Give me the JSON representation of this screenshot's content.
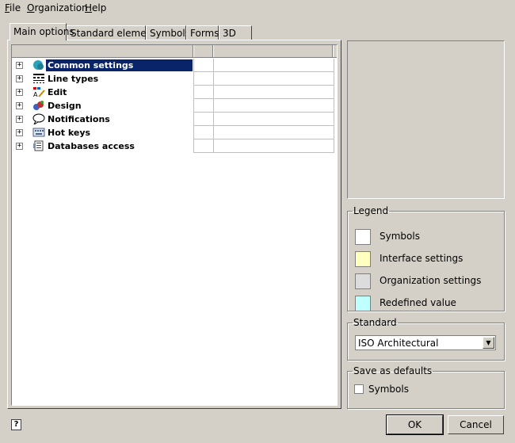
{
  "menu": {
    "file": "File",
    "organization": "Organization",
    "help": "Help"
  },
  "tabs": [
    {
      "label": "Main options",
      "active": true
    },
    {
      "label": "Standard elements",
      "active": false
    },
    {
      "label": "Symbols",
      "active": false
    },
    {
      "label": "Forms",
      "active": false
    },
    {
      "label": "3D",
      "active": false
    }
  ],
  "tree": {
    "items": [
      {
        "label": "Common settings",
        "icon": "common-settings-icon",
        "selected": true
      },
      {
        "label": "Line types",
        "icon": "line-types-icon",
        "selected": false
      },
      {
        "label": "Edit",
        "icon": "edit-icon",
        "selected": false
      },
      {
        "label": "Design",
        "icon": "design-icon",
        "selected": false
      },
      {
        "label": "Notifications",
        "icon": "notifications-icon",
        "selected": false
      },
      {
        "label": "Hot keys",
        "icon": "hot-keys-icon",
        "selected": false
      },
      {
        "label": "Databases access",
        "icon": "databases-access-icon",
        "selected": false
      }
    ]
  },
  "legend": {
    "title": "Legend",
    "items": [
      {
        "label": "Symbols",
        "color": "#ffffff"
      },
      {
        "label": "Interface settings",
        "color": "#ffffc0"
      },
      {
        "label": "Organization settings",
        "color": "#dcdcdc"
      },
      {
        "label": "Redefined value",
        "color": "#c0ffff"
      }
    ]
  },
  "standard": {
    "title": "Standard",
    "selected": "ISO Architectural"
  },
  "save_defaults": {
    "title": "Save as defaults",
    "checkbox_label": "Symbols",
    "checked": false
  },
  "buttons": {
    "ok": "OK",
    "cancel": "Cancel"
  },
  "colors": {
    "window_bg": "#d4d0c8",
    "selection": "#0a246a"
  }
}
